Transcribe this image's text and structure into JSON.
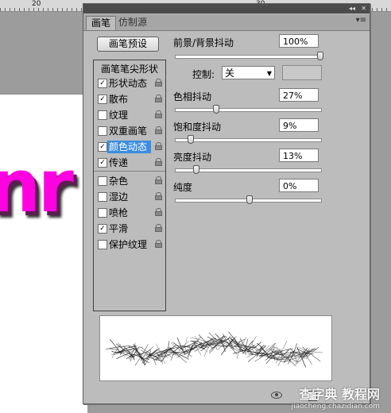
{
  "ruler": {
    "ticks": [
      "20",
      "30"
    ]
  },
  "canvas": {
    "art_text": "nr"
  },
  "panel": {
    "tabs": [
      "画笔",
      "仿制源"
    ],
    "preset_button": "画笔预设",
    "list_header": "画笔笔尖形状",
    "items": [
      {
        "label": "形状动态",
        "checked": true
      },
      {
        "label": "散布",
        "checked": true
      },
      {
        "label": "纹理",
        "checked": false
      },
      {
        "label": "双重画笔",
        "checked": false
      },
      {
        "label": "颜色动态",
        "checked": true,
        "selected": true
      },
      {
        "label": "传递",
        "checked": true
      },
      {
        "label": "杂色",
        "checked": false
      },
      {
        "label": "湿边",
        "checked": false
      },
      {
        "label": "喷枪",
        "checked": false
      },
      {
        "label": "平滑",
        "checked": true
      },
      {
        "label": "保护纹理",
        "checked": false
      }
    ],
    "fg_bg_jitter": {
      "label": "前景/背景抖动",
      "value": "100%",
      "level": 1.0
    },
    "control": {
      "label": "控制:",
      "value": "关"
    },
    "hue_jitter": {
      "label": "色相抖动",
      "value": "27%",
      "level": 0.27
    },
    "saturation_jitter": {
      "label": "饱和度抖动",
      "value": "9%",
      "level": 0.09
    },
    "brightness_jitter": {
      "label": "亮度抖动",
      "value": "13%",
      "level": 0.13
    },
    "purity": {
      "label": "纯度",
      "value": "0%",
      "level": 0.5
    }
  },
  "watermark": {
    "line1": "查字典 教程网",
    "line2": "jiaocheng.chazidian.com"
  }
}
